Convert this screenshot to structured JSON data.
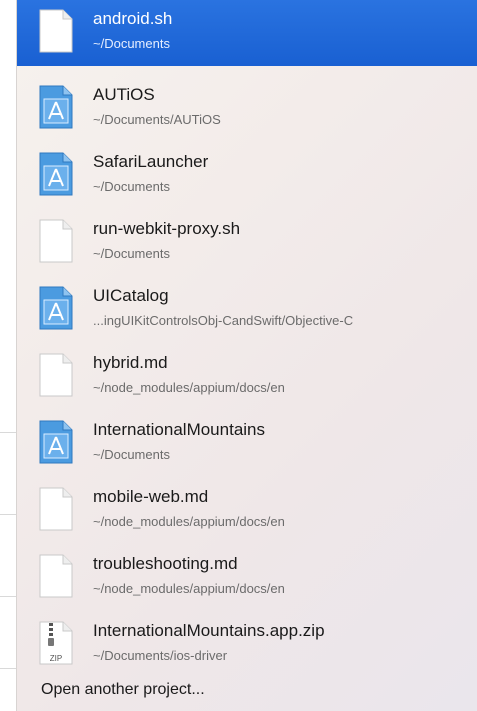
{
  "recent_projects": [
    {
      "name": "android.sh",
      "path": "~/Documents",
      "icon": "document-icon",
      "selected": true
    },
    {
      "name": "AUTiOS",
      "path": "~/Documents/AUTiOS",
      "icon": "xcode-project-icon"
    },
    {
      "name": "SafariLauncher",
      "path": "~/Documents",
      "icon": "xcode-project-icon"
    },
    {
      "name": "run-webkit-proxy.sh",
      "path": "~/Documents",
      "icon": "document-icon"
    },
    {
      "name": "UICatalog",
      "path": "...ingUIKitControlsObj-CandSwift/Objective-C",
      "icon": "xcode-project-icon"
    },
    {
      "name": "hybrid.md",
      "path": "~/node_modules/appium/docs/en",
      "icon": "document-icon"
    },
    {
      "name": "InternationalMountains",
      "path": "~/Documents",
      "icon": "xcode-project-icon"
    },
    {
      "name": "mobile-web.md",
      "path": "~/node_modules/appium/docs/en",
      "icon": "document-icon"
    },
    {
      "name": "troubleshooting.md",
      "path": "~/node_modules/appium/docs/en",
      "icon": "document-icon"
    },
    {
      "name": "InternationalMountains.app.zip",
      "path": "~/Documents/ios-driver",
      "icon": "zip-archive-icon",
      "icon_label": "ZIP"
    }
  ],
  "open_another_label": "Open another project...",
  "colors": {
    "selection": "#1b67d8",
    "xcode_icon": "#3d8fd8"
  }
}
